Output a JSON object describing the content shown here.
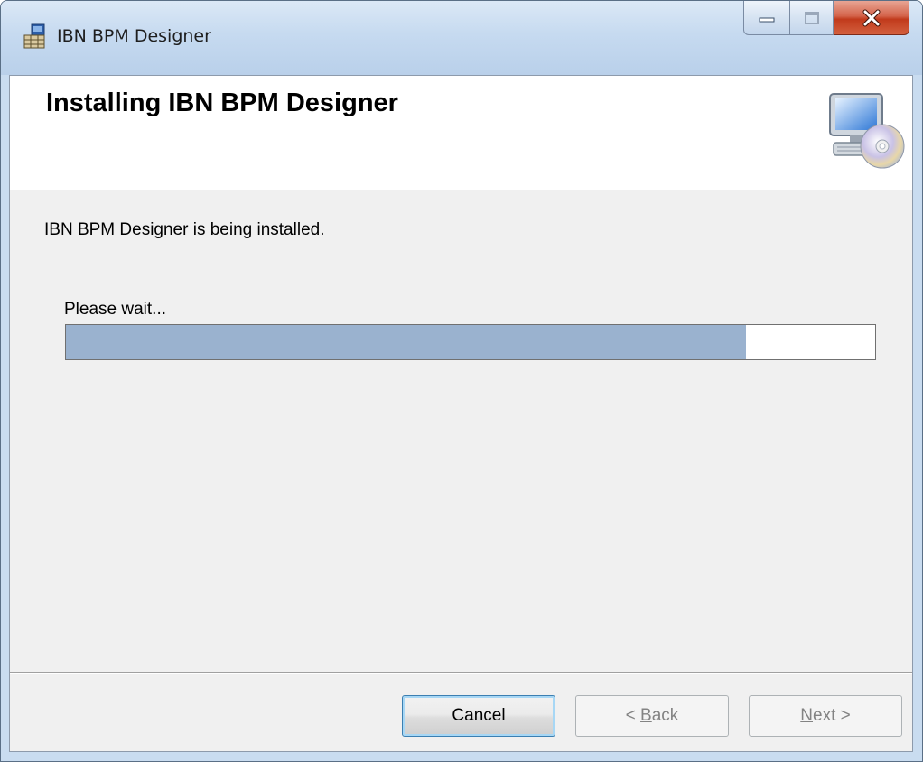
{
  "window": {
    "title": "IBN BPM Designer",
    "app_icon": "installer-icon",
    "caption_buttons": [
      "minimize-icon",
      "maximize-icon",
      "close-icon"
    ]
  },
  "banner": {
    "title": "Installing IBN BPM Designer",
    "icon": "computer-disc-icon"
  },
  "body": {
    "status_text": "IBN BPM Designer is being installed.",
    "wait_text": "Please wait...",
    "progress_percent": 84
  },
  "buttons": {
    "cancel": "Cancel",
    "back_prefix": "< ",
    "back_mnemonic": "B",
    "back_rest": "ack",
    "next_mnemonic": "N",
    "next_rest": "ext >"
  },
  "colors": {
    "progress_fill": "#9ab2cf",
    "close_button": "#c13a1c",
    "titlebar": "#c6daf0",
    "client_bg": "#f0f0f0"
  }
}
